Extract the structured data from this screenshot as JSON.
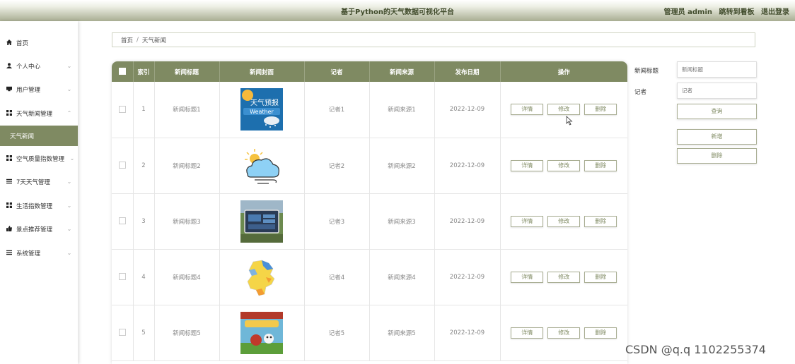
{
  "header": {
    "title": "基于Python的天气数据可视化平台",
    "user_label": "管理员 admin",
    "dashboard_link": "跳转到看板",
    "logout_link": "退出登录"
  },
  "sidebar": {
    "items": [
      {
        "icon": "home-icon",
        "label": "首页"
      },
      {
        "icon": "user-icon",
        "label": "个人中心"
      },
      {
        "icon": "id-card-icon",
        "label": "用户管理"
      },
      {
        "icon": "grid-icon",
        "label": "天气新闻管理"
      },
      {
        "icon": "",
        "label": "天气新闻"
      },
      {
        "icon": "grid-icon",
        "label": "空气质量指数管理"
      },
      {
        "icon": "list-icon",
        "label": "7天天气管理"
      },
      {
        "icon": "grid-icon",
        "label": "生活指数管理"
      },
      {
        "icon": "thumb-up-icon",
        "label": "景点推荐管理"
      },
      {
        "icon": "list-icon",
        "label": "系统管理"
      }
    ]
  },
  "breadcrumb": {
    "home": "首页",
    "separator": "/",
    "current": "天气新闻"
  },
  "table": {
    "headers": [
      "索引",
      "新闻标题",
      "新闻封面",
      "记者",
      "新闻来源",
      "发布日期",
      "操作"
    ],
    "actions": {
      "detail": "详情",
      "edit": "修改",
      "delete": "删除"
    },
    "rows": [
      {
        "index": "1",
        "title": "新闻标题1",
        "reporter": "记者1",
        "source": "新闻来源1",
        "date": "2022-12-09"
      },
      {
        "index": "2",
        "title": "新闻标题2",
        "reporter": "记者2",
        "source": "新闻来源2",
        "date": "2022-12-09"
      },
      {
        "index": "3",
        "title": "新闻标题3",
        "reporter": "记者3",
        "source": "新闻来源3",
        "date": "2022-12-09"
      },
      {
        "index": "4",
        "title": "新闻标题4",
        "reporter": "记者4",
        "source": "新闻来源4",
        "date": "2022-12-09"
      },
      {
        "index": "5",
        "title": "新闻标题5",
        "reporter": "记者5",
        "source": "新闻来源5",
        "date": "2022-12-09"
      }
    ]
  },
  "cover_text": {
    "forecast": "天气预报",
    "weather": "Weather"
  },
  "search": {
    "title_label": "新闻标题",
    "title_placeholder": "新闻标题",
    "reporter_label": "记者",
    "reporter_placeholder": "记者",
    "query_button": "查询",
    "add_button": "新增",
    "delete_button": "删除"
  },
  "watermark": "CSDN @q.q 1102255374",
  "colors": {
    "accent": "#7f8a62",
    "header_gradient_end": "#a8ad92"
  }
}
